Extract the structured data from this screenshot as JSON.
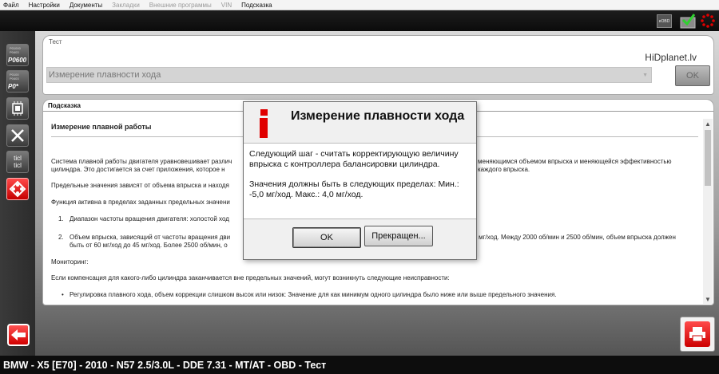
{
  "menu": {
    "items": [
      {
        "label": "Файл",
        "enabled": true
      },
      {
        "label": "Настройки",
        "enabled": true
      },
      {
        "label": "Документы",
        "enabled": true
      },
      {
        "label": "Закладки",
        "enabled": false
      },
      {
        "label": "Внешние программы",
        "enabled": false
      },
      {
        "label": "VIN",
        "enabled": false
      },
      {
        "label": "Подсказка",
        "enabled": true
      }
    ]
  },
  "toolbar": {
    "obd_label": "eOBD",
    "icons": [
      "obd-connector-icon",
      "check-ok-icon",
      "busy-spinner-icon"
    ]
  },
  "sidebar": {
    "buttons": [
      {
        "name": "fault-memory",
        "small_text": "P01000 P0403",
        "code": "P0600",
        "icon": "fault-memory-icon"
      },
      {
        "name": "fault-memory-delete",
        "small_text": "P0100 P0403",
        "code": "P0*",
        "icon": "fault-memory-delete-icon"
      },
      {
        "name": "control-unit",
        "icon": "ecu-chip-icon"
      },
      {
        "name": "service-functions",
        "icon": "tools-icon"
      },
      {
        "name": "ticl",
        "text_top": "ticl",
        "text_bottom": "ticl",
        "icon": "ticl-icon"
      },
      {
        "name": "tests",
        "icon": "tests-icon",
        "active": true
      }
    ],
    "back_icon": "back-arrow-icon"
  },
  "test_panel": {
    "tab_label": "Тест",
    "brand": "HiDplanet.lv",
    "selected_test": "Измерение плавности хода",
    "ok_label": "OK"
  },
  "hint_panel": {
    "tab_label": "Подсказка",
    "title": "Измерение плавной работы",
    "paragraphs": [
      "Система плавной работы двигателя уравновешивает различ",
      "Предельные значения зависят от объема впрыска и находя",
      "Функция активна в пределах заданных предельных значени"
    ],
    "p1_line1_right": "меняющимся объемом впрыска и меняющейся эффективностью",
    "p1_line2": "цилиндра. Это достигается за счет приложения, которое н",
    "p1_line2_right": "каждого впрыска.",
    "list": [
      {
        "num": "1.",
        "text": "Диапазон частоты вращения двигателя: холостой ход"
      },
      {
        "num": "2.",
        "text": "Объем впрыска, зависящий от частоты вращения дви",
        "text_right": "мг/ход. Между 2000 об/мин и 2500 об/мин, объем впрыска должен",
        "line2": "быть от 60 мг/ход до 45 мг/ход. Более 2500 об/мин, о"
      }
    ],
    "monitoring": "Мониторинг:",
    "compensation": "Если компенсация для какого-либо цилиндра заканчивается вне предельных значений, могут возникнуть следующие неисправности:",
    "bullet": "Регулировка плавного хода, объем коррекции слишком высок или низок: Значение для как минимум одного цилиндра было ниже или выше предельного значения."
  },
  "dialog": {
    "icon": "info-icon",
    "title": "Измерение плавности хода",
    "message1": "Следующий шаг - считать  корректирующую величину впрыска с контроллера балансировки цилиндра.",
    "message2": "Значения должны быть в следующих пределах: Мин.: -5,0 мг/ход. Макс.: 4,0 мг/ход.",
    "ok_label": "OK",
    "cancel_label": "Прекращен..."
  },
  "print_icon": "print-icon",
  "status_bar": "BMW - X5 [E70] - 2010 - N57 2.5/3.0L - DDE 7.31 - MT/AT - OBD - Тест",
  "colors": {
    "accent_red": "#d10000",
    "dark_bar": "#0d0d0d",
    "dialog_bg": "#f0f0f0"
  }
}
